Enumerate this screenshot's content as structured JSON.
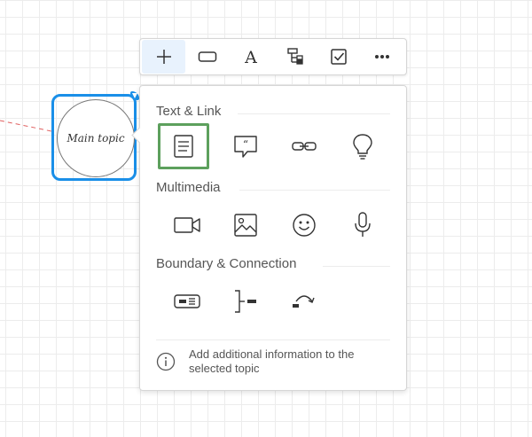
{
  "canvas": {
    "topic": {
      "label": "Main topic"
    }
  },
  "toolbar": {
    "buttons": [
      {
        "icon": "plus-icon",
        "active": true
      },
      {
        "icon": "rectangle-icon"
      },
      {
        "icon": "text-icon",
        "glyph": "A"
      },
      {
        "icon": "hierarchy-icon"
      },
      {
        "icon": "checkbox-icon"
      },
      {
        "icon": "more-icon",
        "glyph": "•••"
      }
    ]
  },
  "panel": {
    "sections": [
      {
        "title": "Text & Link",
        "items": [
          "note-icon",
          "comment-icon",
          "link-icon",
          "idea-icon"
        ],
        "selected": "note-icon"
      },
      {
        "title": "Multimedia",
        "items": [
          "video-icon",
          "image-icon",
          "emoji-icon",
          "microphone-icon"
        ]
      },
      {
        "title": "Boundary & Connection",
        "items": [
          "boundary-icon",
          "summary-icon",
          "relationship-icon"
        ]
      }
    ],
    "footer": {
      "icon": "info-icon",
      "text": "Add additional information to the selected topic"
    }
  },
  "colors": {
    "selection": "#1a8fe8",
    "highlight": "#5da05d",
    "connector": "#e06060"
  }
}
